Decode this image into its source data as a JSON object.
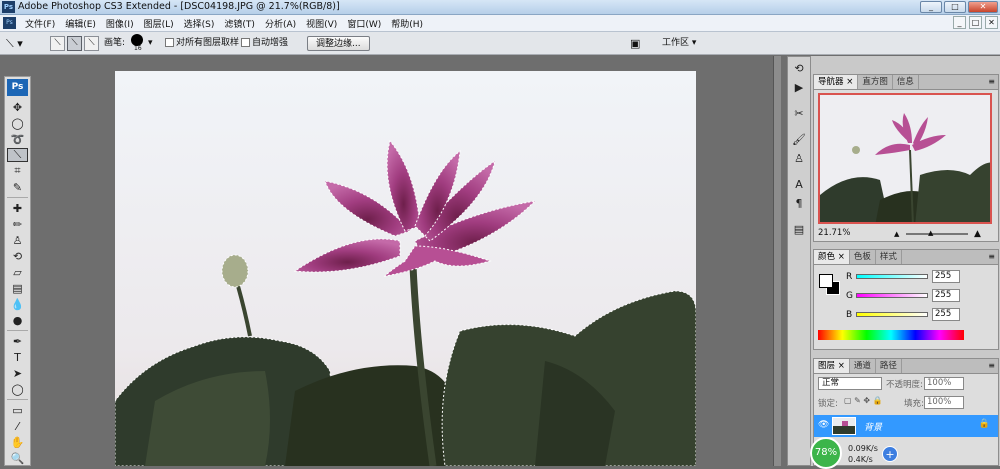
{
  "titlebar": {
    "app_icon": "Ps",
    "title": "Adobe Photoshop CS3 Extended - [DSC04198.JPG @ 21.7%(RGB/8)]",
    "buttons": [
      "_",
      "□",
      "✕"
    ]
  },
  "menubar": {
    "icon": "Ps",
    "items": [
      "文件(F)",
      "编辑(E)",
      "图像(I)",
      "图层(L)",
      "选择(S)",
      "滤镜(T)",
      "分析(A)",
      "视图(V)",
      "窗口(W)",
      "帮助(H)"
    ],
    "doc_buttons": [
      "_",
      "□",
      "✕"
    ]
  },
  "options": {
    "brush_label": "画笔:",
    "brush_size": "16",
    "sample_all_layers": "对所有图层取样",
    "auto_enhance": "自动增强",
    "refine_edge": "调整边缘...",
    "workspace": "工作区 ▾"
  },
  "tools": [
    "move-tool",
    "marquee-tool",
    "lasso-tool",
    "quick-selection-tool",
    "crop-tool",
    "slice-tool",
    "healing-brush-tool",
    "brush-tool",
    "clone-stamp-tool",
    "history-brush-tool",
    "eraser-tool",
    "gradient-tool",
    "blur-tool",
    "dodge-tool",
    "pen-tool",
    "type-tool",
    "path-selection-tool",
    "shape-tool",
    "notes-tool",
    "eyedropper-tool",
    "hand-tool",
    "zoom-tool"
  ],
  "navigator": {
    "tabs": [
      "导航器",
      "直方图",
      "信息"
    ],
    "zoom": "21.71%"
  },
  "color": {
    "tabs": [
      "颜色",
      "色板",
      "样式"
    ],
    "channels": [
      {
        "label": "R",
        "value": "255"
      },
      {
        "label": "G",
        "value": "255"
      },
      {
        "label": "B",
        "value": "255"
      }
    ],
    "colors": {
      "accent_red": "#d9534f",
      "selection": "#3399ff"
    }
  },
  "layers": {
    "tabs": [
      "图层",
      "通道",
      "路径"
    ],
    "blend_mode": "正常",
    "opacity_label": "不透明度:",
    "opacity": "100%",
    "lock_label": "锁定:",
    "fill_label": "填充:",
    "fill": "100%",
    "layer_name": "背景"
  },
  "netmon": {
    "percent": "78%",
    "up": "0.09K/s",
    "down": "0.4K/s"
  }
}
